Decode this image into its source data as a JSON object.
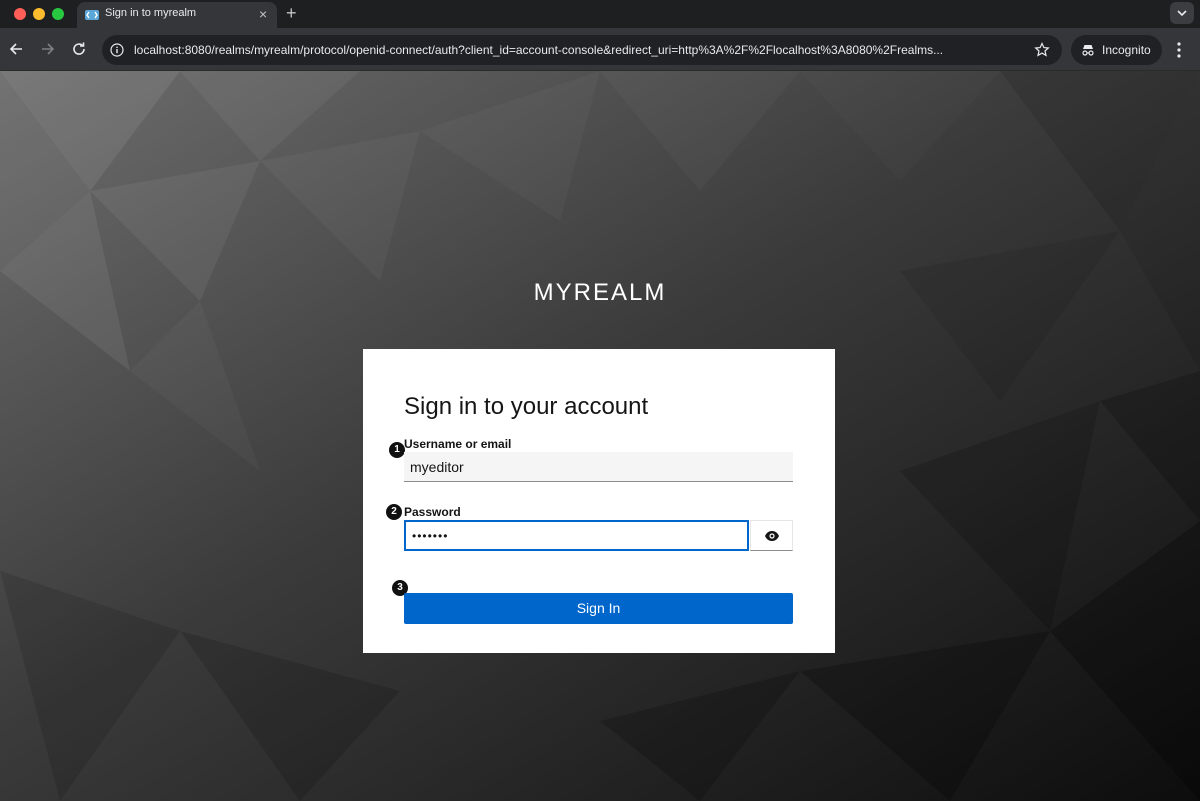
{
  "browser": {
    "tab": {
      "title": "Sign in to myrealm"
    },
    "new_tab_label": "+",
    "url": "localhost:8080/realms/myrealm/protocol/openid-connect/auth?client_id=account-console&redirect_uri=http%3A%2F%2Flocalhost%3A8080%2Frealms...",
    "incognito_label": "Incognito"
  },
  "page": {
    "realm_name": "MYREALM",
    "card": {
      "title": "Sign in to your account",
      "username": {
        "label": "Username or email",
        "value": "myeditor",
        "step": "1"
      },
      "password": {
        "label": "Password",
        "masked_value": "•••••••",
        "step": "2"
      },
      "submit": {
        "label": "Sign In",
        "step": "3"
      }
    }
  },
  "colors": {
    "primary_button": "#0066cc",
    "focus_border": "#0066cc",
    "card_background": "#ffffff"
  }
}
